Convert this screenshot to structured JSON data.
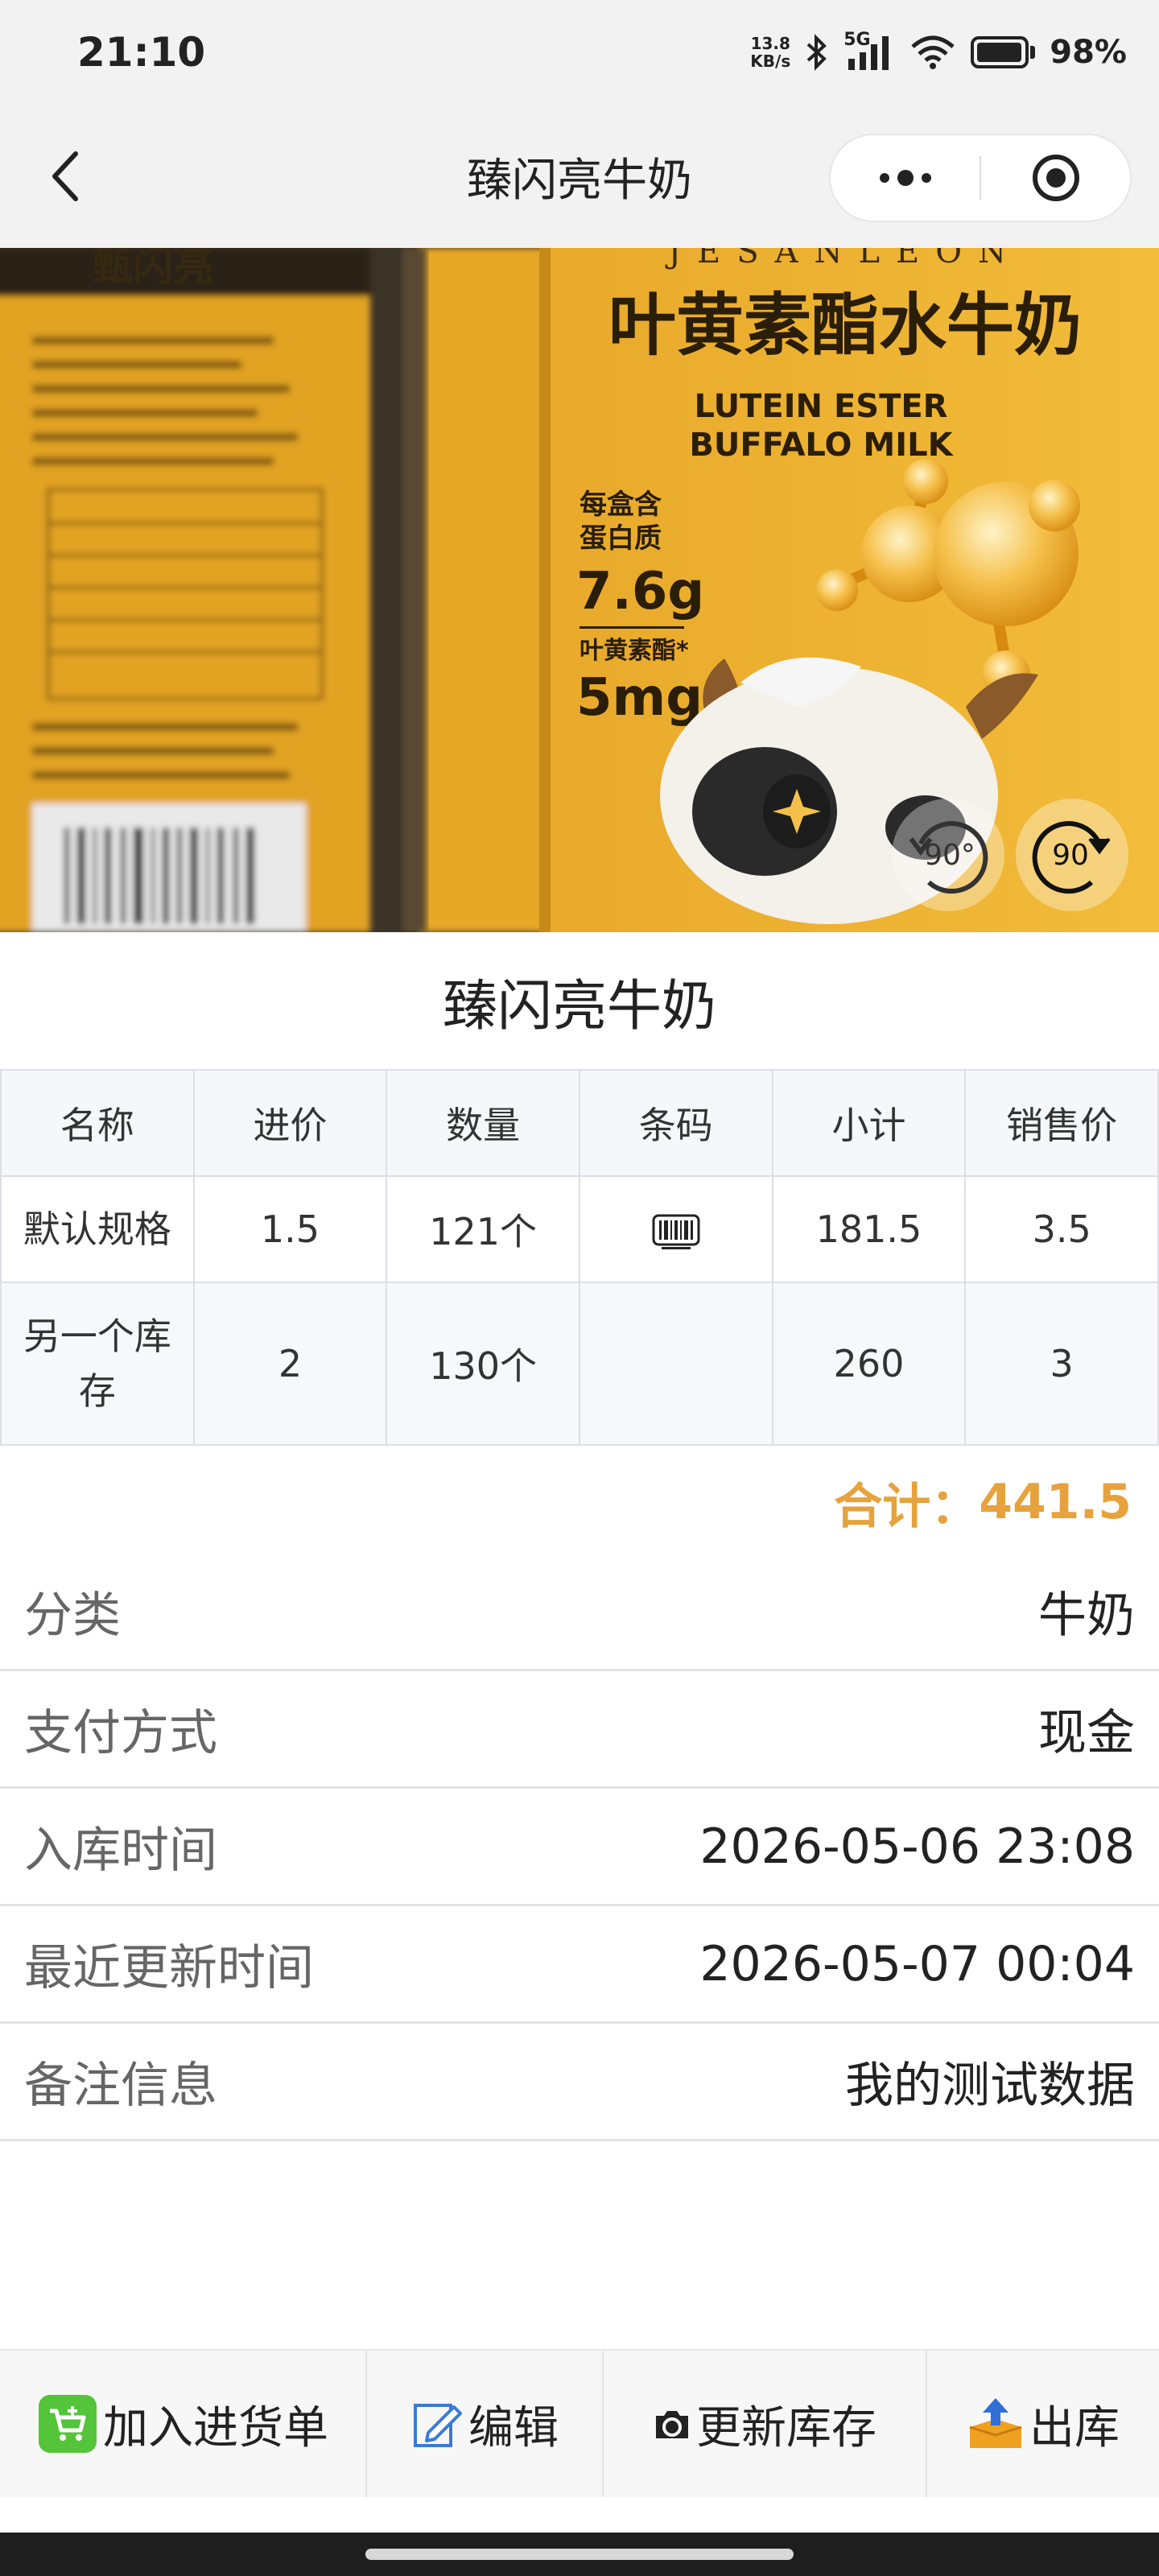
{
  "status_bar": {
    "time": "21:10",
    "net_speed_value": "13.8",
    "net_speed_unit": "KB/s",
    "network": "5G",
    "battery_percent": "98%",
    "battery_level": 0.98
  },
  "nav": {
    "title": "臻闪亮牛奶",
    "back_icon": "chevron-left-icon",
    "more_icon": "more-dots-icon",
    "close_icon": "target-circle-icon"
  },
  "hero": {
    "brand_text": "JESANLEON",
    "left_brand": "甄闪亮",
    "product_title_cn": "叶黄素酯水牛奶",
    "product_title_en_1": "LUTEIN ESTER",
    "product_title_en_2": "BUFFALO MILK",
    "protein_label_1": "每盒含",
    "protein_label_2": "蛋白质",
    "protein_value": "7.6g",
    "lutein_label": "叶黄素酯*",
    "lutein_value": "5mg",
    "rotate_left_label": "90°",
    "rotate_right_label": "90"
  },
  "product": {
    "name": "臻闪亮牛奶"
  },
  "table": {
    "headers": [
      "名称",
      "进价",
      "数量",
      "条码",
      "小计",
      "销售价"
    ],
    "rows": [
      {
        "name": "默认规格",
        "price": "1.5",
        "qty": "121个",
        "barcode_icon": "barcode-icon",
        "subtotal": "181.5",
        "sale": "3.5"
      },
      {
        "name": "另一个库存",
        "price": "2",
        "qty": "130个",
        "barcode_icon": "",
        "subtotal": "260",
        "sale": "3"
      }
    ]
  },
  "total": {
    "label": "合计：",
    "value": "441.5",
    "color": "#e6a23c"
  },
  "info": {
    "category_label": "分类",
    "category_value": "牛奶",
    "payment_label": "支付方式",
    "payment_value": "现金",
    "stockin_label": "入库时间",
    "stockin_value": "2026-05-06 23:08",
    "updated_label": "最近更新时间",
    "updated_value": "2026-05-07 00:04",
    "remark_label": "备注信息",
    "remark_value": "我的测试数据"
  },
  "actions": {
    "add_purchase": "加入进货单",
    "edit": "编辑",
    "update_stock": "更新库存",
    "stock_out": "出库"
  }
}
